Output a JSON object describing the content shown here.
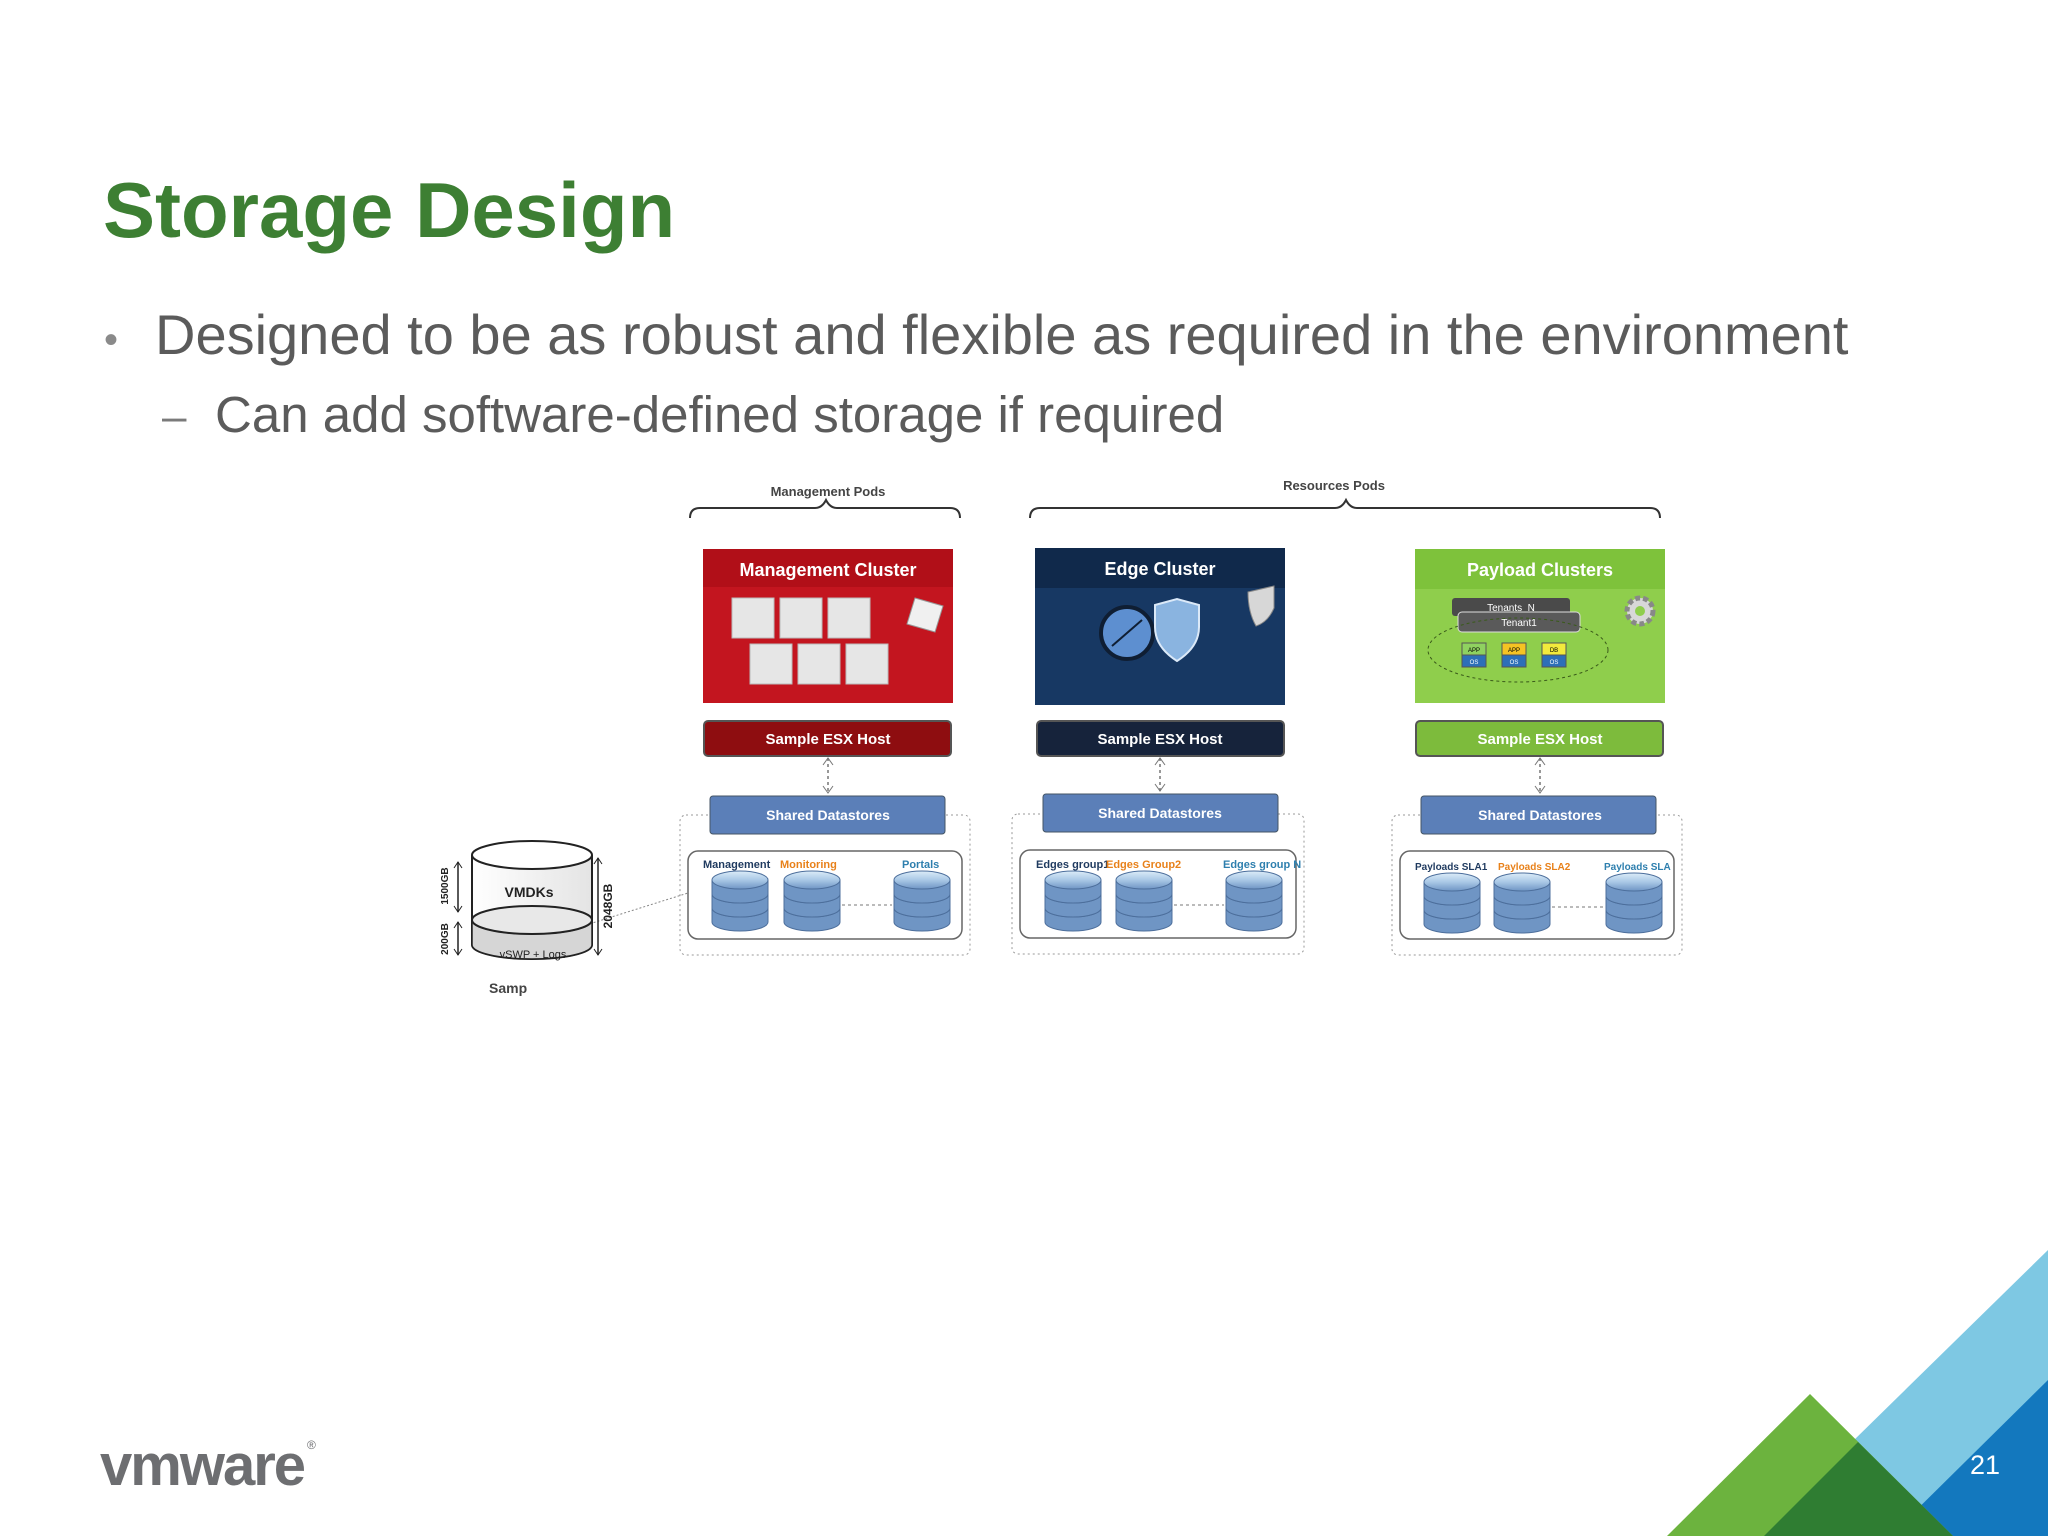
{
  "slide": {
    "title": "Storage Design",
    "bullet1": "Designed to be as robust and flexible as required in the environment",
    "bullet2": "Can add software-defined storage if required",
    "page_number": "21",
    "logo": "vmware"
  },
  "diagram": {
    "brace_management": "Management Pods",
    "brace_resources": "Resources Pods",
    "clusters": [
      {
        "title": "Management Cluster",
        "host": "Sample ESX Host",
        "shared": "Shared Datastores",
        "stores": [
          "Management",
          "Monitoring",
          "Portals"
        ],
        "vm_tile": "Virtual Machines",
        "color": "#c3151f",
        "host_color": "#8e0d10"
      },
      {
        "title": "Edge Cluster",
        "host": "Sample ESX Host",
        "shared": "Shared Datastores",
        "stores": [
          "Edges group1",
          "Edges Group2",
          "Edges group N"
        ],
        "color": "#173863",
        "host_color": "#16233b"
      },
      {
        "title": "Payload Clusters",
        "host": "Sample ESX Host",
        "shared": "Shared Datastores",
        "stores": [
          "Payloads SLA1",
          "Payloads SLA2",
          "Payloads SLA"
        ],
        "tenant_n": "Tenants_N",
        "tenant1": "Tenant1",
        "apps": [
          "APP",
          "APP",
          "DB"
        ],
        "os": "OS",
        "color": "#8fce4c",
        "host_color": "#7dbb3c"
      }
    ],
    "shared_color": "#5b7fb8",
    "store_label_colors": [
      "#1f3a5f",
      "#e8811a",
      "#2e7fae"
    ],
    "cylinder": {
      "top_label": "VMDKs",
      "bottom_label": "vSWP + Logs",
      "dim_top": "1500GB",
      "dim_bottom": "200GB",
      "dim_total": "2048GB",
      "caption": "Samp"
    }
  },
  "colors": {
    "title": "#3d7f33",
    "body_text": "#5b5b5b",
    "corner_light_blue": "#7ec8e3",
    "corner_blue": "#1378be",
    "corner_green": "#6cb33e",
    "corner_dark_green": "#2f7d32"
  }
}
